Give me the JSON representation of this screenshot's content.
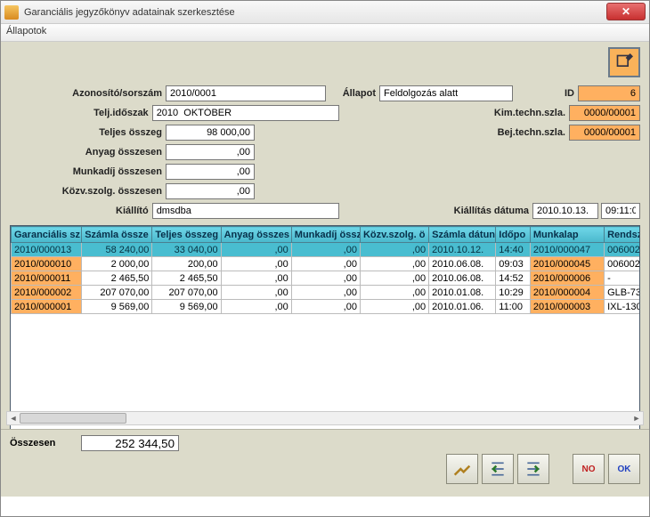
{
  "window": {
    "title": "Garanciális jegyzőkönyv adatainak szerkesztése"
  },
  "menu": {
    "allapotok": "Állapotok"
  },
  "form": {
    "labels": {
      "azon": "Azonosító/sorszám",
      "telj": "Telj.időszak",
      "teljes": "Teljes összeg",
      "anyag": "Anyag összesen",
      "munkadij": "Munkadíj összesen",
      "kozv": "Közv.szolg. összesen",
      "kiallito": "Kiállító",
      "allapot": "Állapot",
      "id": "ID",
      "kim": "Kim.techn.szla.",
      "bej": "Bej.techn.szla.",
      "kiall_datum": "Kiállítás dátuma"
    },
    "values": {
      "azon": "2010/0001",
      "telj": "2010  OKTÓBER",
      "teljes": "98 000,00",
      "anyag": ",00",
      "munkadij": ",00",
      "kozv": ",00",
      "kiallito": "dmsdba",
      "allapot": "Feldolgozás alatt",
      "id": "6",
      "kim": "0000/00001",
      "bej": "0000/00001",
      "kiall_datum": "2010.10.13.",
      "kiall_time": "09:11:0"
    }
  },
  "grid": {
    "headers": [
      "Garanciális sz",
      "Számla össze",
      "Teljes összeg",
      "Anyag összes",
      "Munkadíj össz",
      "Közv.szolg. ö",
      "Számla dátun",
      "Időpo",
      "Munkalap",
      "Rendsz"
    ],
    "rows": [
      {
        "sel": true,
        "c": [
          "2010/000013",
          "58 240,00",
          "33 040,00",
          ",00",
          ",00",
          ",00",
          "2010.10.12.",
          "14:40",
          "2010/000047",
          "006002"
        ]
      },
      {
        "sel": false,
        "c": [
          "2010/000010",
          "2 000,00",
          "200,00",
          ",00",
          ",00",
          ",00",
          "2010.06.08.",
          "09:03",
          "2010/000045",
          "006002"
        ]
      },
      {
        "sel": false,
        "c": [
          "2010/000011",
          "2 465,50",
          "2 465,50",
          ",00",
          ",00",
          ",00",
          "2010.06.08.",
          "14:52",
          "2010/000006",
          "-"
        ]
      },
      {
        "sel": false,
        "c": [
          "2010/000002",
          "207 070,00",
          "207 070,00",
          ",00",
          ",00",
          ",00",
          "2010.01.08.",
          "10:29",
          "2010/000004",
          "GLB-73"
        ]
      },
      {
        "sel": false,
        "c": [
          "2010/000001",
          "9 569,00",
          "9 569,00",
          ",00",
          ",00",
          ",00",
          "2010.01.06.",
          "11:00",
          "2010/000003",
          "IXL-130"
        ]
      }
    ]
  },
  "footer": {
    "sum_label": "Összesen",
    "sum_value": "252 344,50",
    "ok": "OK",
    "no": "NO"
  }
}
